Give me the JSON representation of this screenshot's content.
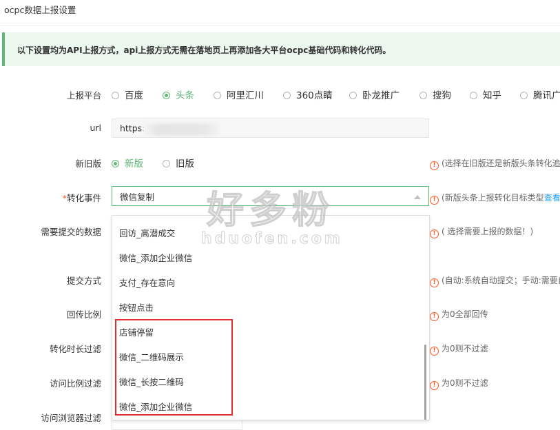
{
  "page": {
    "title": "ocpc数据上报设置"
  },
  "notice": {
    "text": "以下设置均为API上报方式，api上报方式无需在落地页上再添加各大平台ocpc基础代码和转化代码。"
  },
  "platform": {
    "label": "上报平台",
    "options": [
      "百度",
      "头条",
      "阿里汇川",
      "360点睛",
      "卧龙推广",
      "搜狗",
      "知乎",
      "腾讯广"
    ],
    "selected": "头条"
  },
  "url": {
    "label": "url",
    "value": "https:/"
  },
  "version": {
    "label": "新旧版",
    "options": [
      "新版",
      "旧版"
    ],
    "selected": "新版",
    "hint": "(选择在旧版还是新版头条转化追"
  },
  "conversion": {
    "required_mark": "*",
    "label": "转化事件",
    "value": "微信复制",
    "hint": "(新版头条上报转化目标类型",
    "hint_link": "查看",
    "dropdown_items": [
      "回访_高潜成交",
      "微信_添加企业微信",
      "支付_存在意向",
      "按钮点击",
      "店铺停留",
      "微信_二维码展示",
      "微信_长按二维码",
      "微信_添加企业微信"
    ]
  },
  "fields": {
    "submit_data": {
      "label": "需要提交的数据",
      "hint": "( 选择需要上报的数据！)"
    },
    "submit_method": {
      "label": "提交方式",
      "hint": "(自动:系统自动提交；手动:需要自"
    },
    "return_ratio": {
      "label": "回传比例",
      "hint": "为0全部回传"
    },
    "duration_filter": {
      "label": "转化时长过滤",
      "hint": "为0则不过滤"
    },
    "visit_ratio_filter": {
      "label": "访问比例过滤",
      "hint": "为0则不过滤"
    },
    "browser_filter": {
      "label": "访问浏览器过滤"
    }
  },
  "watermark": {
    "cn": "好多粉",
    "en": "hduofen.com"
  },
  "colors": {
    "accent": "#5fb878",
    "warn": "#ff5722",
    "highlight": "#e02d2d",
    "link": "#1e9fff"
  }
}
